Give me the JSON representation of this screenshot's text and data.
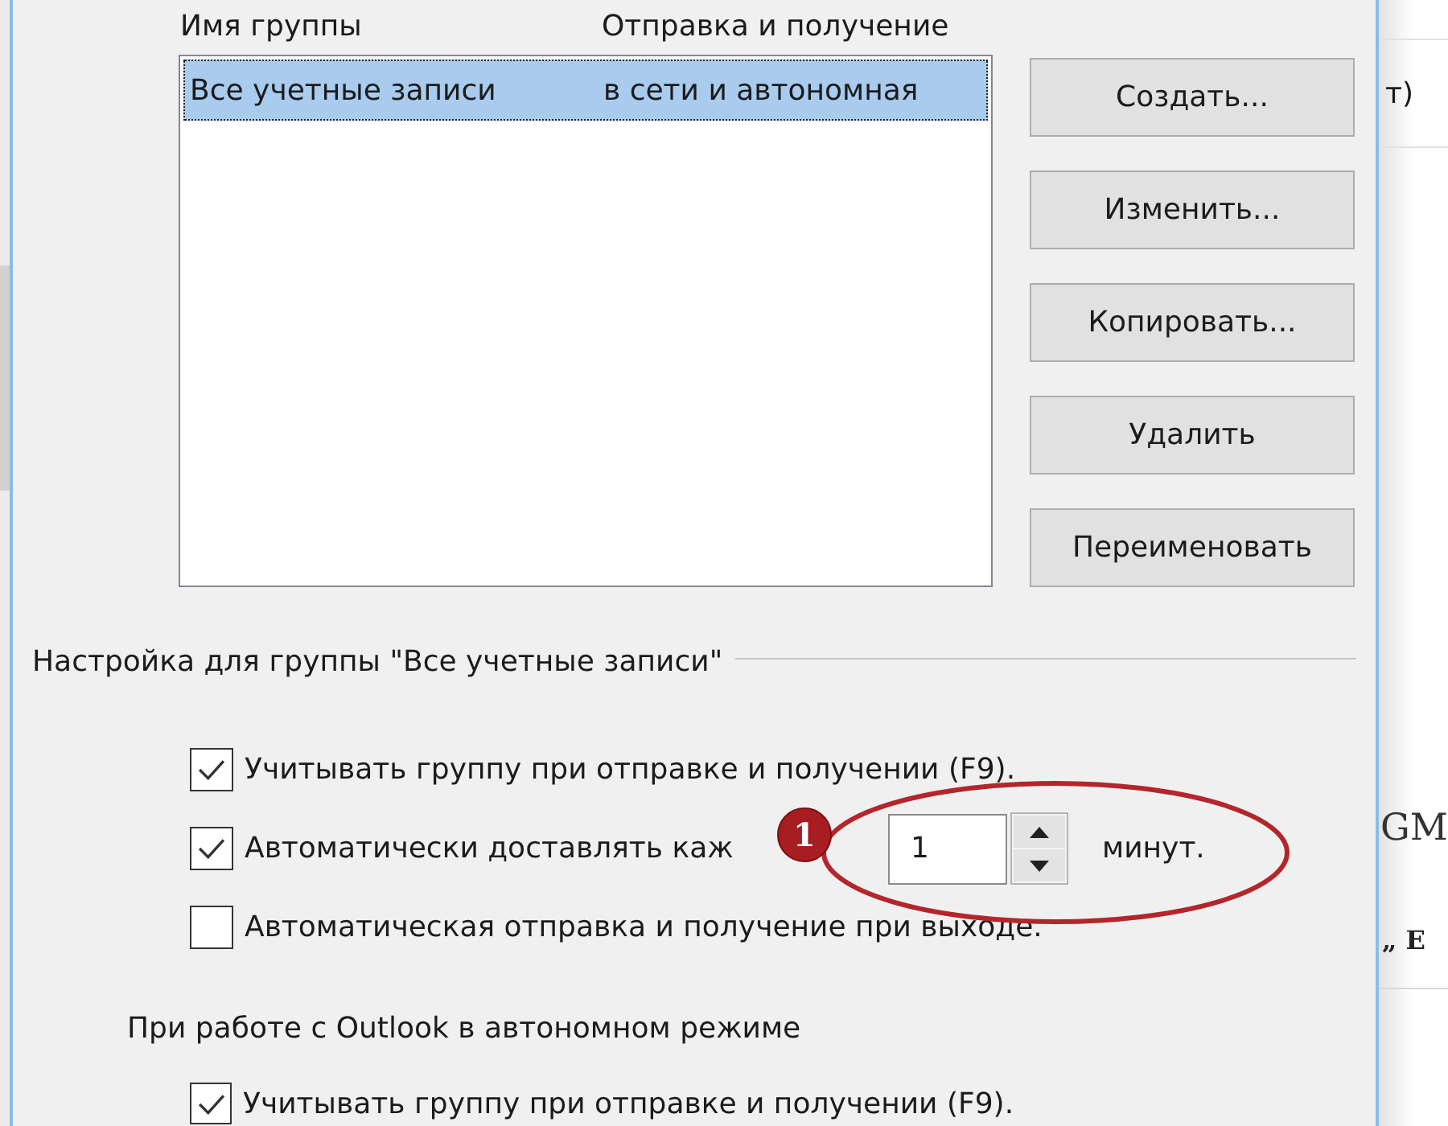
{
  "dialog": {
    "group_list": {
      "columns": [
        "Имя группы",
        "Отправка и получение"
      ],
      "rows": [
        {
          "name": "Все учетные записи",
          "send_receive": "в сети и автономная",
          "selected": true
        }
      ]
    },
    "buttons": [
      "Создать...",
      "Изменить...",
      "Копировать...",
      "Удалить",
      "Переименовать"
    ],
    "group_settings": {
      "title": "Настройка для группы \"Все учетные записи\"",
      "options": [
        {
          "kind": "checkbox",
          "label": "Учитывать группу при отправке и получении (F9).",
          "checked": true
        },
        {
          "kind": "interval",
          "label": "Автоматически доставлять каж",
          "checked": true,
          "value": "1",
          "unit": "минут."
        },
        {
          "kind": "checkbox",
          "label": "Автоматическая отправка и получение при выходе.",
          "checked": false
        }
      ]
    },
    "offline": {
      "title": "При работе с Outlook в автономном режиме",
      "options": [
        {
          "kind": "checkbox",
          "label": "Учитывать группу при отправке и получении (F9).",
          "checked": true
        }
      ]
    }
  },
  "annotation": {
    "badge": "1"
  },
  "background_window": {
    "texts": [
      "т)",
      "GM",
      "„ Е"
    ]
  }
}
